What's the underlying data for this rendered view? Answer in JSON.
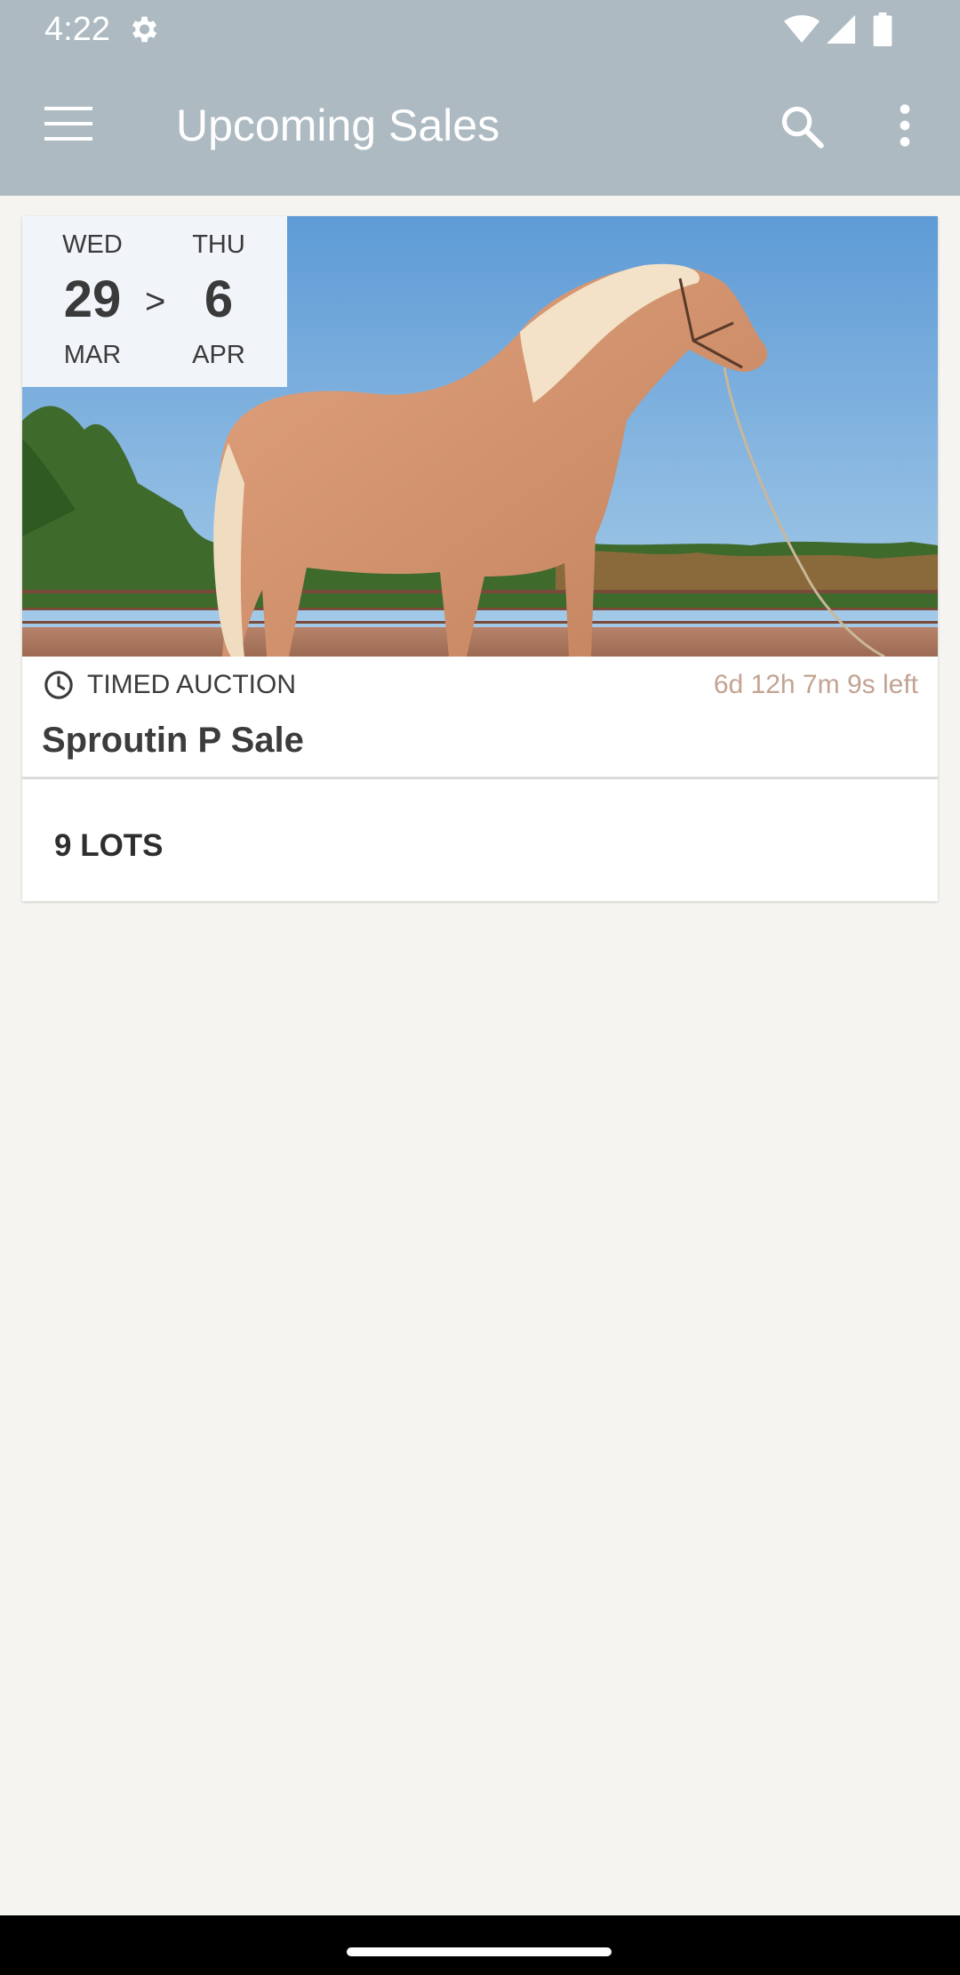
{
  "status_bar": {
    "time": "4:22",
    "icons": [
      "settings-icon",
      "wifi-icon",
      "signal-icon",
      "battery-icon"
    ]
  },
  "app_bar": {
    "title": "Upcoming Sales",
    "background_color": "#adbac2",
    "icons": [
      "menu-icon",
      "search-icon",
      "more-vert-icon"
    ]
  },
  "sale_card": {
    "image": "palomino horse standing in an arena",
    "start": {
      "day_of_week": "WED",
      "day": "29",
      "month": "MAR"
    },
    "arrow": ">",
    "end": {
      "day_of_week": "THU",
      "day": "6",
      "month": "APR"
    },
    "sale_type": "TIMED AUCTION",
    "time_left": "6d 12h 7m 9s left",
    "time_left_color": "#c2a392",
    "name": "Sproutin P Sale",
    "lots": "9 LOTS"
  }
}
